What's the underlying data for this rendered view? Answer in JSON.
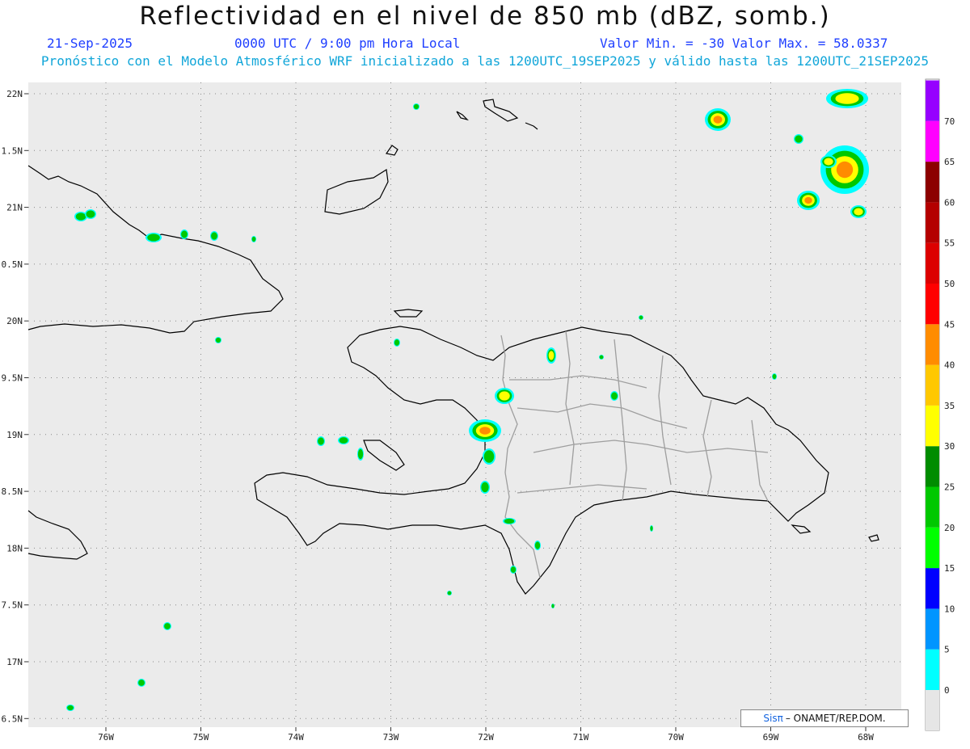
{
  "header": {
    "title": "Reflectividad en el nivel de 850 mb (dBZ, somb.)",
    "date": "21-Sep-2025",
    "time": "0000 UTC / 9:00 pm Hora Local",
    "minmax": "Valor Min. = -30  Valor Max. = 58.0337",
    "model_line": "Pronóstico con el Modelo Atmosférico WRF inicializado a las 1200UTC_19SEP2025 y válido hasta las  1200UTC_21SEP2025"
  },
  "map": {
    "lon_range": [
      -76.75,
      -67.65
    ],
    "lat_range": [
      6.45,
      22.1
    ],
    "lat_ticks": [
      "22N",
      "1.5N",
      "21N",
      "0.5N",
      "20N",
      "9.5N",
      "19N",
      "8.5N",
      "18N",
      "7.5N",
      "17N",
      "6.5N"
    ],
    "lon_ticks": [
      "76W",
      "75W",
      "74W",
      "73W",
      "72W",
      "71W",
      "70W",
      "69W",
      "68W"
    ],
    "background_color": "#ebebeb",
    "grid": "dotted"
  },
  "colorbar": {
    "labels": [
      "0",
      "5",
      "10",
      "15",
      "20",
      "25",
      "30",
      "35",
      "40",
      "45",
      "50",
      "55",
      "60",
      "65",
      "70"
    ],
    "colors": [
      "#00ffff",
      "#0095ff",
      "#0000ff",
      "#00ff00",
      "#00c800",
      "#008c00",
      "#ffff00",
      "#ffc800",
      "#ff8c00",
      "#ff0000",
      "#dc0000",
      "#b40000",
      "#8c0000",
      "#ff00ff",
      "#9600ff"
    ]
  },
  "credit": {
    "brand": "Sisπ",
    "text": "– ONAMET/REP.DOM."
  }
}
